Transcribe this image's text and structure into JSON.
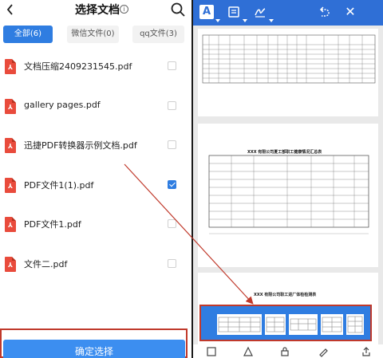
{
  "left": {
    "title": "选择文档",
    "tabs": [
      {
        "label": "全部(6)"
      },
      {
        "label": "微信文件(0)"
      },
      {
        "label": "qq文件(3)"
      }
    ],
    "files": [
      {
        "name": "文档压缩2409231545.pdf",
        "checked": false
      },
      {
        "name": "gallery pages.pdf",
        "checked": false
      },
      {
        "name": "迅捷PDF转换器示例文档.pdf",
        "checked": false
      },
      {
        "name": "PDF文件1(1).pdf",
        "checked": true
      },
      {
        "name": "PDF文件1.pdf",
        "checked": false
      },
      {
        "name": "文件二.pdf",
        "checked": false
      }
    ],
    "confirm_label": "确定选择"
  },
  "right": {
    "toolbar": {
      "text_tool": "A",
      "icons": [
        "text-tool-icon",
        "note-icon",
        "signature-icon",
        "undo-icon",
        "close-icon"
      ]
    },
    "page2_title": "XXX 有限公司夏工部职工健康情况汇总表",
    "page3_title": "XXX 有限公司职工进厂体检检测表",
    "bottom_icons": [
      "save-icon",
      "shape-icon",
      "lock-icon",
      "pen-icon",
      "share-icon"
    ]
  },
  "colors": {
    "accent": "#2f7de1",
    "highlight_border": "#c0392b",
    "toolbar": "#2f6fd6",
    "pdf_red": "#e94b3c"
  }
}
